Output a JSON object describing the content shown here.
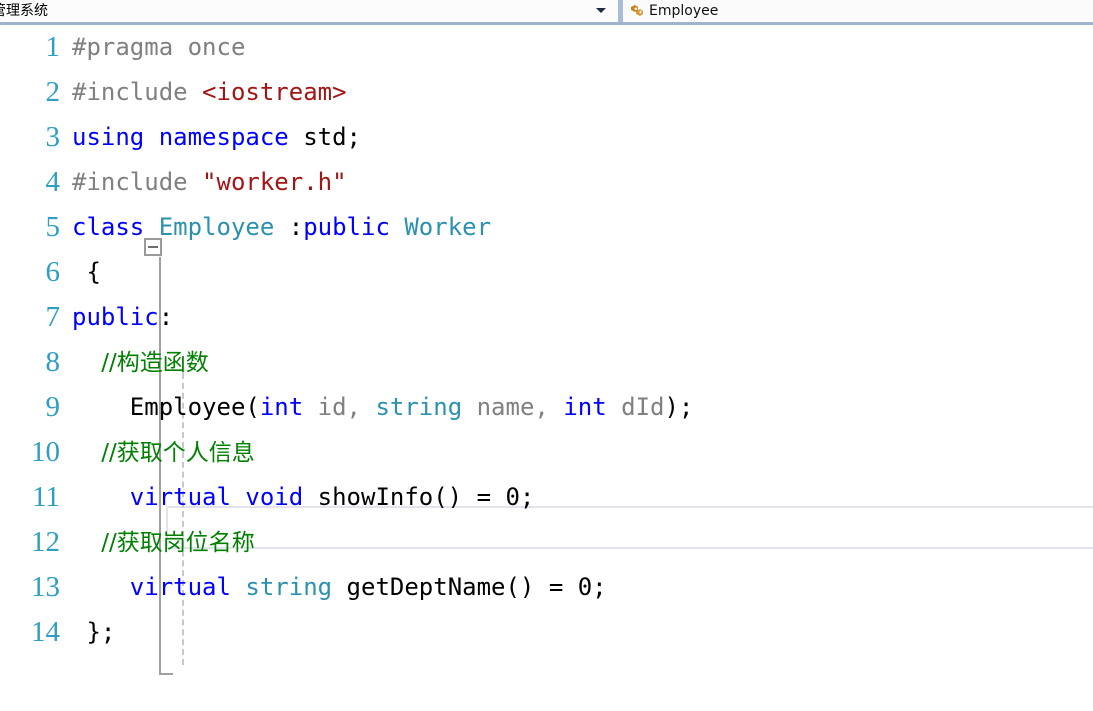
{
  "topbar": {
    "nav_dropdown": {
      "value": "管理系统",
      "icon": "chevron-down-icon"
    },
    "tab": {
      "label": "Employee",
      "icon": "cpp-header-file-icon"
    }
  },
  "editor": {
    "filename": "Employee",
    "current_line": 11,
    "colors": {
      "preprocessor": "#808080",
      "string": "#a31515",
      "keyword": "#0000ff",
      "type": "#2b91af",
      "identifier": "#808080",
      "comment": "#008000",
      "plain": "#000000",
      "line_number": "#2e9ec4"
    },
    "lines": [
      {
        "n": "1",
        "tokens": [
          {
            "t": "#pragma once",
            "c": "t-pre"
          }
        ]
      },
      {
        "n": "2",
        "tokens": [
          {
            "t": "#include ",
            "c": "t-pre"
          },
          {
            "t": "<iostream>",
            "c": "t-str"
          }
        ]
      },
      {
        "n": "3",
        "tokens": [
          {
            "t": "using namespace ",
            "c": "t-kw"
          },
          {
            "t": "std;",
            "c": "t-plain"
          }
        ]
      },
      {
        "n": "4",
        "tokens": [
          {
            "t": "#include ",
            "c": "t-pre"
          },
          {
            "t": "\"worker.h\"",
            "c": "t-str"
          }
        ]
      },
      {
        "n": "5",
        "tokens": [
          {
            "t": "class ",
            "c": "t-kw"
          },
          {
            "t": "Employee",
            "c": "t-type"
          },
          {
            "t": " :",
            "c": "t-plain"
          },
          {
            "t": "public ",
            "c": "t-kw"
          },
          {
            "t": "Worker",
            "c": "t-type"
          }
        ]
      },
      {
        "n": "6",
        "tokens": [
          {
            "t": " {",
            "c": "t-plain"
          }
        ]
      },
      {
        "n": "7",
        "tokens": [
          {
            "t": "public",
            "c": "t-kw"
          },
          {
            "t": ":",
            "c": "t-plain"
          }
        ]
      },
      {
        "n": "8",
        "tokens": [
          {
            "t": "    //构造函数",
            "c": "t-cmt"
          }
        ]
      },
      {
        "n": "9",
        "tokens": [
          {
            "t": "    Employee(",
            "c": "t-plain"
          },
          {
            "t": "int",
            "c": "t-kw"
          },
          {
            "t": " id, ",
            "c": "t-id"
          },
          {
            "t": "string",
            "c": "t-type"
          },
          {
            "t": " name, ",
            "c": "t-id"
          },
          {
            "t": "int",
            "c": "t-kw"
          },
          {
            "t": " dId",
            "c": "t-id"
          },
          {
            "t": ");",
            "c": "t-plain"
          }
        ]
      },
      {
        "n": "10",
        "tokens": [
          {
            "t": "    //获取个人信息",
            "c": "t-cmt"
          }
        ]
      },
      {
        "n": "11",
        "tokens": [
          {
            "t": "    virtual void ",
            "c": "t-kw"
          },
          {
            "t": "showInfo() = 0;",
            "c": "t-plain"
          }
        ]
      },
      {
        "n": "12",
        "tokens": [
          {
            "t": "    //获取岗位名称",
            "c": "t-cmt"
          }
        ]
      },
      {
        "n": "13",
        "tokens": [
          {
            "t": "    virtual ",
            "c": "t-kw"
          },
          {
            "t": "string",
            "c": "t-type"
          },
          {
            "t": " getDeptName() = 0;",
            "c": "t-plain"
          }
        ]
      },
      {
        "n": "14",
        "tokens": [
          {
            "t": " };",
            "c": "t-plain"
          }
        ]
      }
    ]
  }
}
